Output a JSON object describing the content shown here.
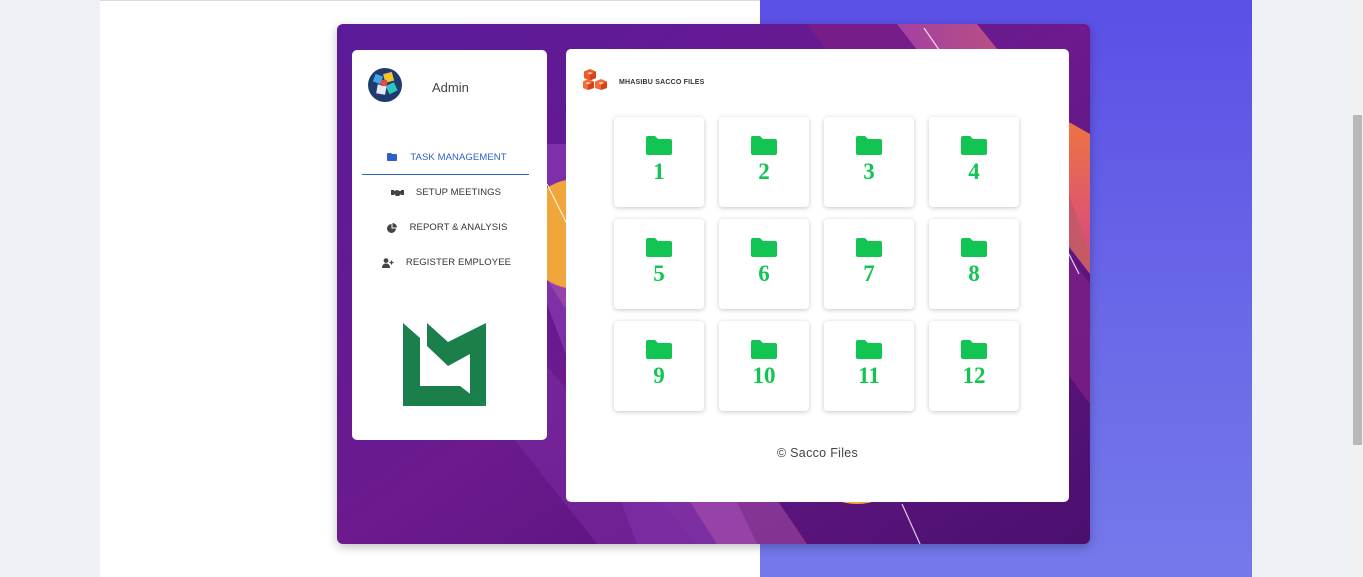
{
  "sidebar": {
    "user_name": "Admin",
    "nav": [
      {
        "label": "TASK MANAGEMENT",
        "icon": "folder-icon",
        "active": true
      },
      {
        "label": "SETUP MEETINGS",
        "icon": "handshake-icon",
        "active": false
      },
      {
        "label": "REPORT & ANALYSIS",
        "icon": "pie-chart-icon",
        "active": false
      },
      {
        "label": "REGISTER EMPLOYEE",
        "icon": "user-plus-icon",
        "active": false
      }
    ]
  },
  "main": {
    "brand_label": "MHASIBU SACCO FILES",
    "folders": [
      "1",
      "2",
      "3",
      "4",
      "5",
      "6",
      "7",
      "8",
      "9",
      "10",
      "11",
      "12"
    ],
    "footer": "© Sacco Files"
  },
  "colors": {
    "accent": "#2f5fc9",
    "folder_green": "#12c553",
    "logo_green": "#1a7f4b",
    "blue_panel": "#5b4fe6"
  }
}
